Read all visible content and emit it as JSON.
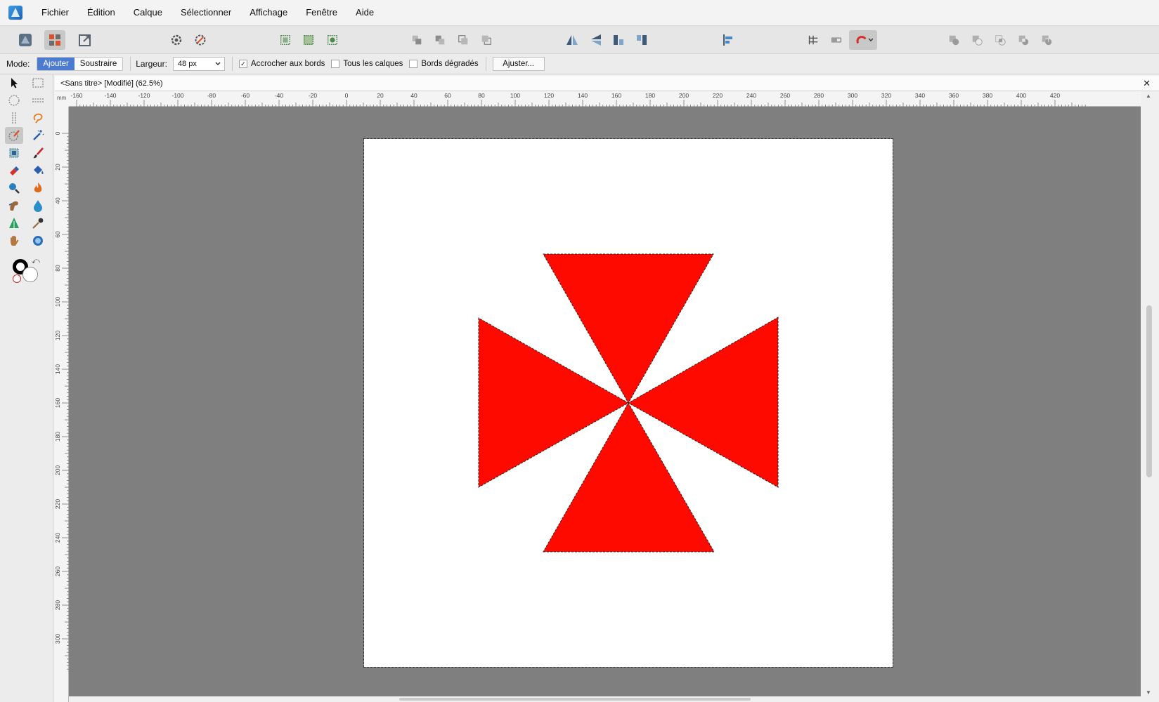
{
  "menu": {
    "items": [
      "Fichier",
      "Édition",
      "Calque",
      "Sélectionner",
      "Affichage",
      "Fenêtre",
      "Aide"
    ]
  },
  "toolbar": {
    "icons": [
      "persona-photo-icon",
      "persona-pixel-icon",
      "persona-export-icon",
      "gear-icon",
      "selection-options-icon",
      "select-all-icon",
      "deselect-icon",
      "invert-selection-icon",
      "arrange-back-icon",
      "arrange-backward-icon",
      "arrange-forward-icon",
      "arrange-front-icon",
      "flip-horizontal-icon",
      "flip-vertical-icon",
      "rotate-left-icon",
      "rotate-right-icon",
      "align-icon",
      "grid-icon",
      "snap-toggle-icon",
      "snapping-magnet-icon",
      "boolean-add-icon",
      "boolean-subtract-icon",
      "boolean-intersect-icon",
      "boolean-xor-icon",
      "boolean-divide-icon"
    ]
  },
  "context": {
    "mode_label": "Mode:",
    "mode_add": "Ajouter",
    "mode_subtract": "Soustraire",
    "width_label": "Largeur:",
    "width_value": "48 px",
    "snap_edges": "Accrocher aux bords",
    "snap_edges_checked": true,
    "all_layers": "Tous les calques",
    "all_layers_checked": false,
    "soft_edges": "Bords dégradés",
    "soft_edges_checked": false,
    "adjust_button": "Ajuster..."
  },
  "document": {
    "title": "<Sans titre> [Modifié] (62.5%)",
    "close_glyph": "✕",
    "units": "mm"
  },
  "rulers": {
    "horizontal_labels": [
      "-160",
      "-140",
      "-120",
      "-100",
      "-80",
      "-60",
      "-40",
      "-20",
      "0",
      "20",
      "40",
      "60",
      "80",
      "100",
      "120",
      "140",
      "160",
      "180",
      "200",
      "220",
      "240",
      "260",
      "280",
      "300",
      "320",
      "340",
      "360",
      "380",
      "400",
      "420"
    ],
    "vertical_labels": [
      "0",
      "20",
      "40",
      "60",
      "80",
      "100",
      "120",
      "140",
      "160",
      "180",
      "200",
      "220",
      "240",
      "260",
      "280",
      "300"
    ]
  },
  "colors": {
    "shape_fill": "#ff0a00",
    "canvas_bg": "#7f7f7f",
    "primary": "#000000",
    "secondary": "#ffffff"
  }
}
